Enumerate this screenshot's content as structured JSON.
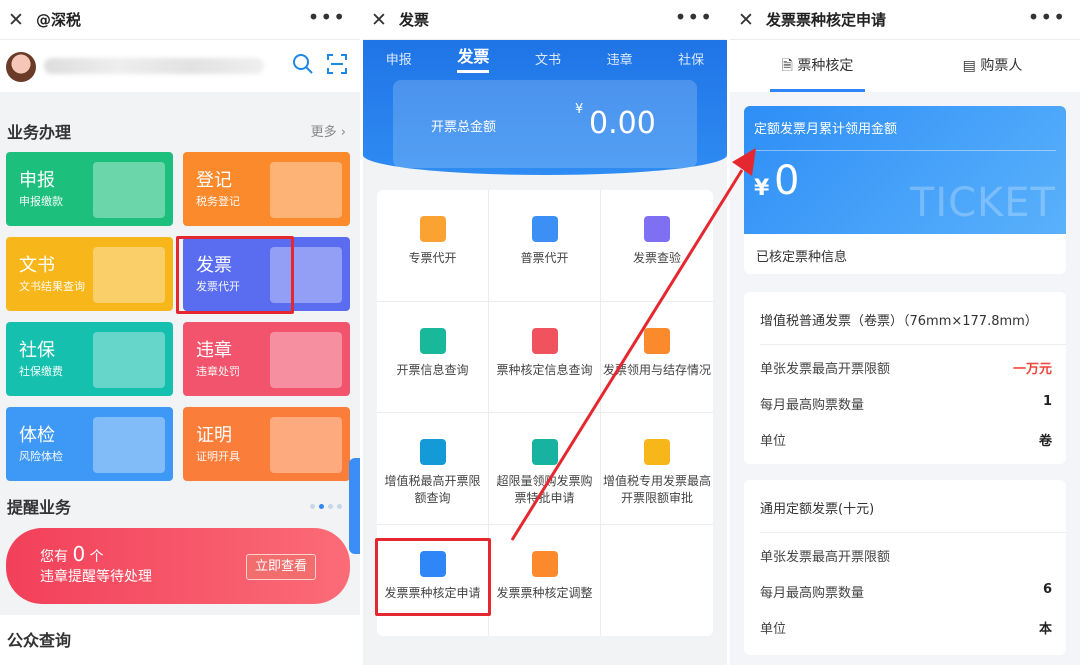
{
  "panel1": {
    "title": "@深税",
    "close": "✕",
    "more": "•••",
    "section1": "业务办理",
    "section1_more": "更多",
    "tiles": [
      {
        "title": "申报",
        "sub": "申报缴款"
      },
      {
        "title": "登记",
        "sub": "税务登记"
      },
      {
        "title": "文书",
        "sub": "文书结果查询"
      },
      {
        "title": "发票",
        "sub": "发票代开"
      },
      {
        "title": "社保",
        "sub": "社保缴费"
      },
      {
        "title": "违章",
        "sub": "违章处罚"
      },
      {
        "title": "体检",
        "sub": "风险体检"
      },
      {
        "title": "证明",
        "sub": "证明开具"
      }
    ],
    "section2": "提醒业务",
    "remind_prefix": "您有",
    "remind_count": "0",
    "remind_suffix": "个",
    "remind_line2": "违章提醒等待处理",
    "remind_button": "立即查看",
    "section3": "公众查询",
    "colors": {
      "green": "#1cc07c",
      "orange": "#fa8a2c",
      "yellow": "#f7b619",
      "purple": "#5a6cf0",
      "teal": "#15c1ae",
      "red": "#f1546c",
      "blue": "#3e98f5",
      "orange2": "#fb7d3a"
    }
  },
  "panel2": {
    "title": "发票",
    "tabs": [
      "申报",
      "发票",
      "文书",
      "违章",
      "社保"
    ],
    "money_label": "开票总金额",
    "currency": "¥",
    "money_value": "0.00",
    "items": [
      "专票代开",
      "普票代开",
      "发票查验",
      "开票信息查询",
      "票种核定信息查询",
      "发票领用与结存情况",
      "增值税最高开票限额查询",
      "超限量领购发票购票特批申请",
      "增值税专用发票最高开票限额审批",
      "发票票种核定申请",
      "发票票种核定调整",
      ""
    ]
  },
  "panel3": {
    "title": "发票票种核定申请",
    "tab1": "票种核定",
    "tab2": "购票人",
    "card_title": "定额发票月累计领用金额",
    "currency": "¥",
    "amount": "0",
    "watermark": "TICKET",
    "card_sub": "已核定票种信息",
    "c1": {
      "title": "增值税普通发票（卷票）（76mm×177.8mm）",
      "r1_label": "单张发票最高开票限额",
      "r1_value": "一万元",
      "r2_label": "每月最高购票数量",
      "r2_value": "1",
      "r3_label": "单位",
      "r3_value": "卷"
    },
    "c2": {
      "title": "通用定额发票(十元)",
      "r1_label": "单张发票最高开票限额",
      "r1_value": "",
      "r2_label": "每月最高购票数量",
      "r2_value": "6",
      "r3_label": "单位",
      "r3_value": "本"
    }
  }
}
